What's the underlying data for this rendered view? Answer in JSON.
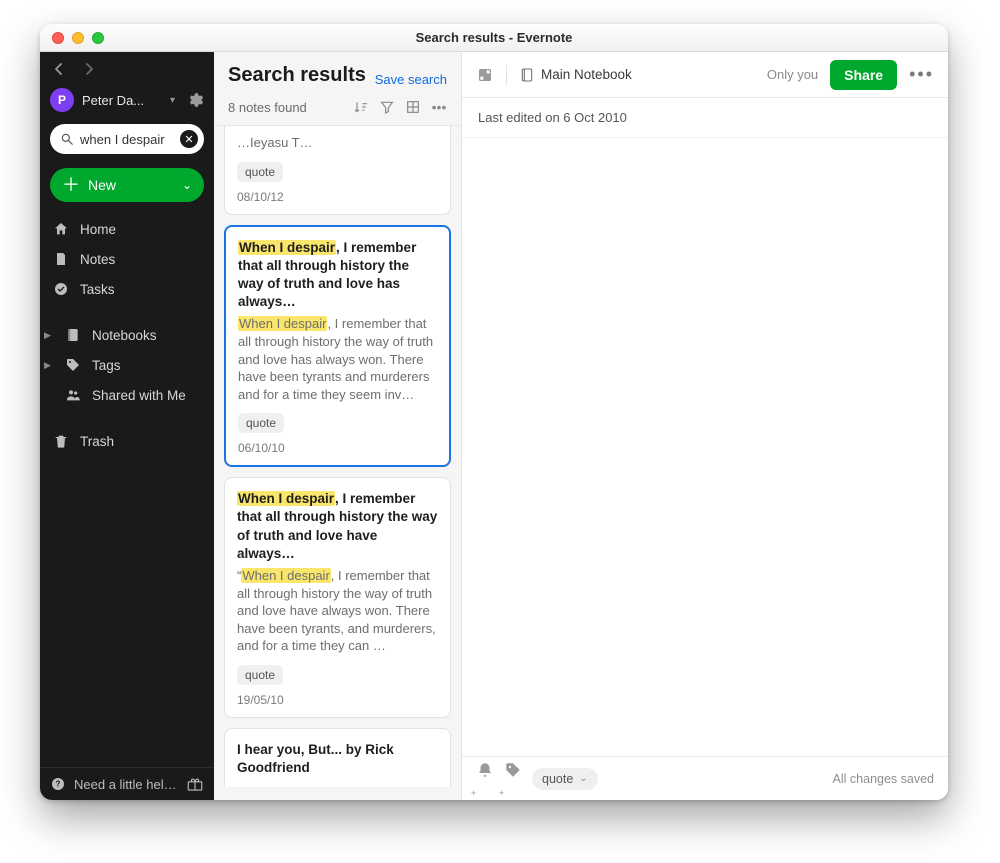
{
  "window": {
    "title": "Search results - Evernote"
  },
  "sidebar": {
    "account_initial": "P",
    "account_name": "Peter Da...",
    "search_value": "when I despair",
    "new_label": "New",
    "items": [
      {
        "label": "Home"
      },
      {
        "label": "Notes"
      },
      {
        "label": "Tasks"
      }
    ],
    "groups": [
      {
        "label": "Notebooks"
      },
      {
        "label": "Tags"
      },
      {
        "label": "Shared with Me"
      }
    ],
    "trash_label": "Trash",
    "footer_label": "Need a little help?"
  },
  "list": {
    "title": "Search results",
    "save_link": "Save search",
    "count_label": "8 notes found",
    "cards": [
      {
        "frag_title": "…Ieyasu T…",
        "tag": "quote",
        "date": "08/10/12"
      },
      {
        "title_pre_hl": "When I despair",
        "title_post": ", I remember that all through history the way of truth and love has always…",
        "snip_pre_hl": "When I despair",
        "snip_post": ", I remember that all through history the way of truth and love has always won. There have been tyrants and murderers and for a time they seem inv…",
        "tag": "quote",
        "date": "06/10/10"
      },
      {
        "title_pre_hl": "When I despair",
        "title_post": ", I remember that all through history the way of truth and love have always…",
        "snip_quote": "“",
        "snip_pre_hl": "When I despair",
        "snip_post": ", I remember that all through history the way of truth and love have always won. There have been tyrants, and murderers, and for a time they can …",
        "tag": "quote",
        "date": "19/05/10"
      },
      {
        "frag_title": "I hear you, But... by Rick Goodfriend"
      }
    ]
  },
  "note": {
    "notebook_name": "Main Notebook",
    "only_you": "Only you",
    "share_label": "Share",
    "last_edited": "Last edited on 6 Oct 2010",
    "footer_tag": "quote",
    "saved_label": "All changes saved"
  }
}
